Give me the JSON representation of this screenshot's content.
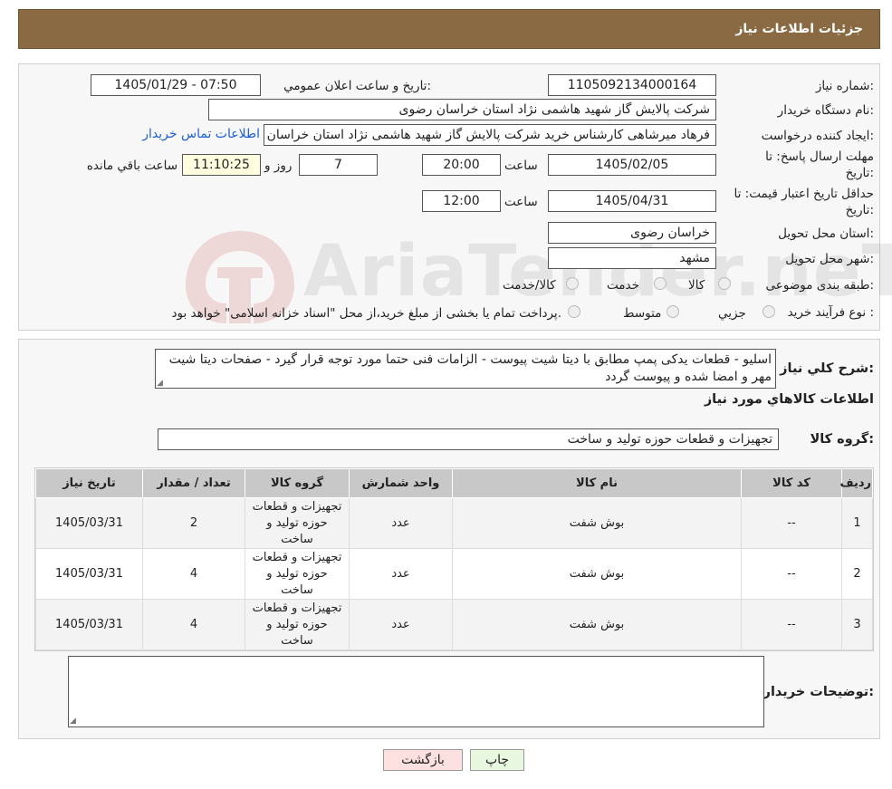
{
  "header": {
    "title": "جزئیات اطلاعات نیاز"
  },
  "fields": {
    "need_number_label": "شماره نیاز:",
    "need_number": "1105092134000164",
    "announce_label": "تاریخ و ساعت اعلان عمومي:",
    "announce_value": "1405/01/29 - 07:50",
    "buyer_org_label": "نام دستگاه خريدار:",
    "buyer_org": "شرکت پالایش گاز شهید هاشمی نژاد   استان خراسان رضوی",
    "requester_label": "ايجاد کننده درخواست:",
    "requester": "فرهاد میرشاهی کارشناس خرید شرکت پالایش گاز شهید هاشمی نژاد   استان خراسان رضوی",
    "contact_link": "اطلاعات تماس خريدار",
    "deadline_label_line1": "مهلت ارسال پاسخ: تا",
    "deadline_label_line2": "تاريخ:",
    "deadline_date": "1405/02/05",
    "time_label": "ساعت",
    "deadline_time": "20:00",
    "days_value": "7",
    "days_label": "روز و",
    "remaining_time": "11:10:25",
    "remaining_label": "ساعت باقي مانده",
    "validity_label_line1": "حداقل تاريخ اعتبار قيمت: تا",
    "validity_label_line2": "تاريخ:",
    "validity_date": "1405/04/31",
    "validity_time": "12:00",
    "province_label": "استان محل تحويل:",
    "province": "خراسان رضوی",
    "city_label": "شهر محل تحويل:",
    "city": "مشهد",
    "category_label": "طبقه بندی موضوعی:",
    "category_options": [
      "کالا",
      "خدمت",
      "کالا/خدمت"
    ],
    "process_label": "نوع فرآيند خريد :",
    "process_options": [
      "جزيي",
      "متوسط"
    ],
    "process_note": "پرداخت تمام يا بخشی از مبلغ خريد،از محل \"اسناد خزانه اسلامی\" خواهد بود."
  },
  "description": {
    "label": "شرح کلي نياز:",
    "text": "اسلیو - قطعات یدکی پمپ مطابق با دیتا شیت پیوست - الزامات فنی حتما مورد توجه قرار گیرد - صفحات دیتا شیت مهر و امضا شده و پیوست گردد"
  },
  "goods_section": {
    "title": "اطلاعات کالاهاي مورد نياز",
    "group_label": "گروه کالا:",
    "group_value": "تجهیزات و قطعات حوزه تولید و ساخت"
  },
  "table": {
    "headers": [
      "رديف",
      "کد کالا",
      "نام کالا",
      "واحد شمارش",
      "گروه کالا",
      "تعداد / مقدار",
      "تاريخ نياز"
    ],
    "rows": [
      [
        "1",
        "--",
        "بوش شفت",
        "عدد",
        "تجهیزات و قطعات حوزه تولید و ساخت",
        "2",
        "1405/03/31"
      ],
      [
        "2",
        "--",
        "بوش شفت",
        "عدد",
        "تجهیزات و قطعات حوزه تولید و ساخت",
        "4",
        "1405/03/31"
      ],
      [
        "3",
        "--",
        "بوش شفت",
        "عدد",
        "تجهیزات و قطعات حوزه تولید و ساخت",
        "4",
        "1405/03/31"
      ]
    ]
  },
  "buyer_notes": {
    "label": "توضيحات خريدار:",
    "value": ""
  },
  "buttons": {
    "print": "چاپ",
    "back": "بازگشت"
  },
  "watermark_text": "AriaTender.neT",
  "colors": {
    "header_bg": "#8a6a42",
    "link": "#1b5fd1",
    "back_button_bg": "#fde0e0",
    "print_button_bg": "#e8f8e0",
    "remaining_bg": "#ffffe0"
  }
}
